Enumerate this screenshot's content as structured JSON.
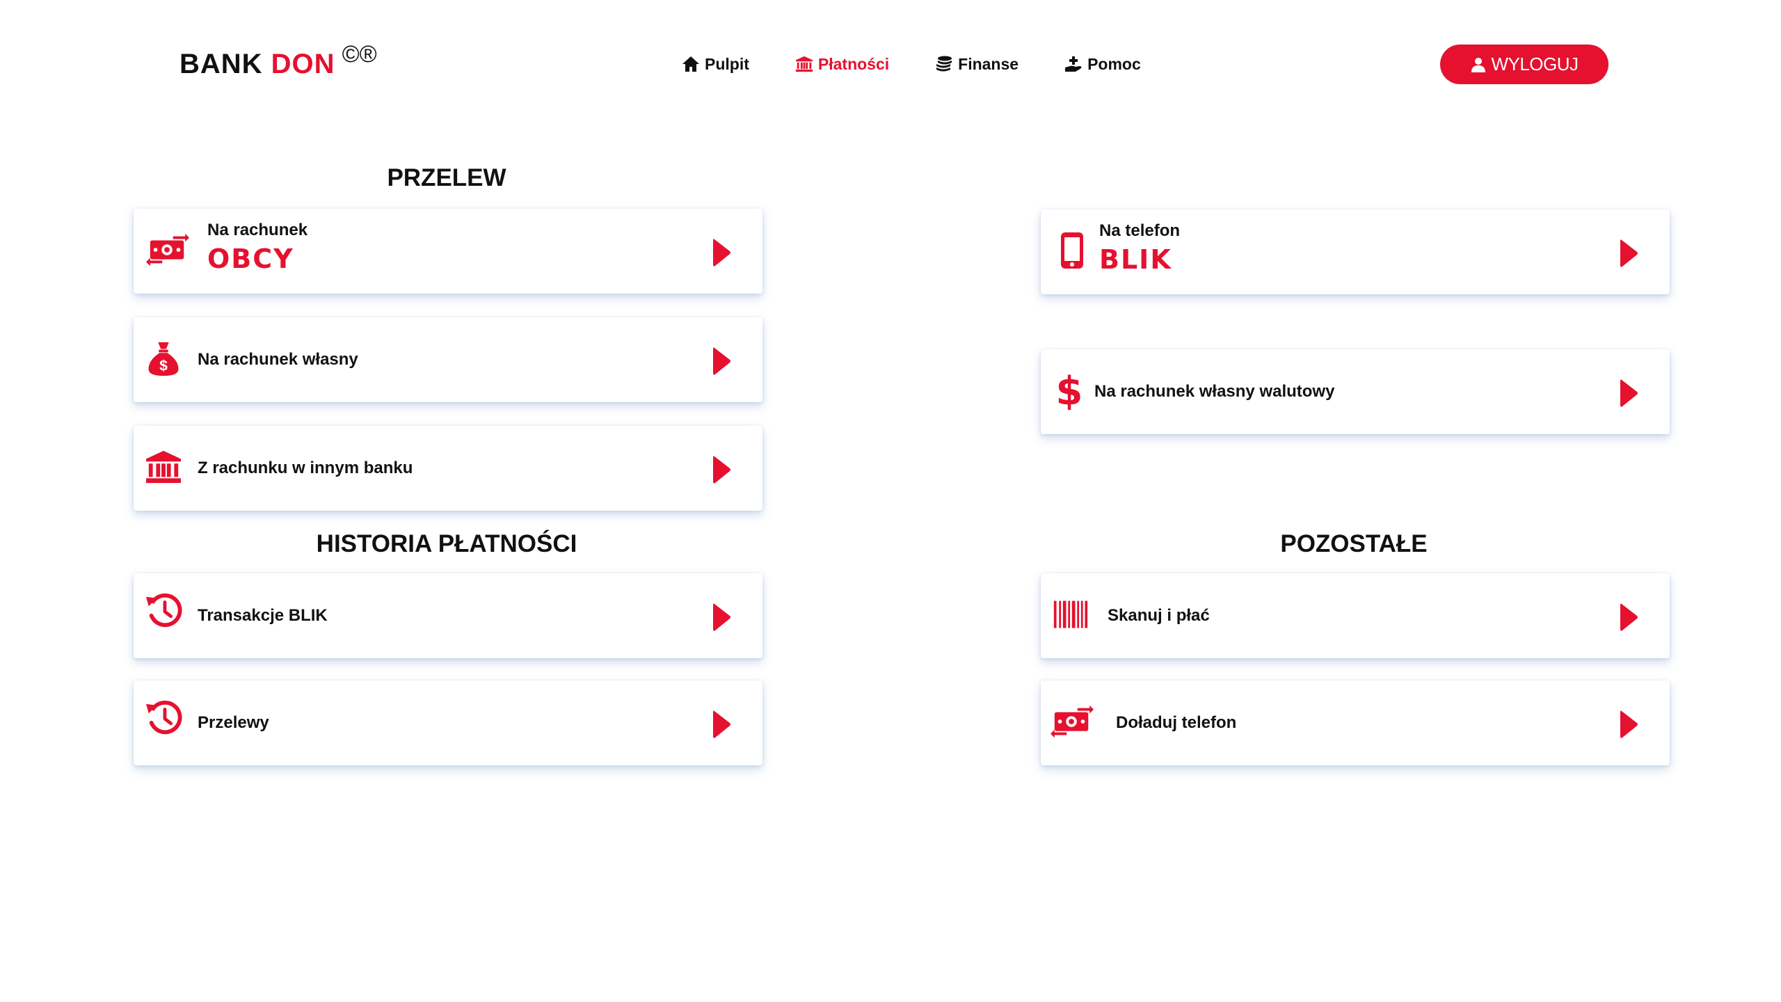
{
  "header": {
    "logo_bank": "BANK",
    "logo_don": "DON",
    "logo_marks": "©®",
    "nav": [
      {
        "label": "Pulpit",
        "icon": "home-icon",
        "active": false
      },
      {
        "label": "Płatności",
        "icon": "bank-icon",
        "active": true
      },
      {
        "label": "Finanse",
        "icon": "coins-icon",
        "active": false
      },
      {
        "label": "Pomoc",
        "icon": "helping-hand-icon",
        "active": false
      }
    ],
    "logout_label": "WYLOGUJ"
  },
  "sections": {
    "przelew": {
      "title": "PRZELEW",
      "items": [
        {
          "small": "Na rachunek",
          "big": "OBCY",
          "icon": "money-transfer-icon"
        },
        {
          "label": "Na rachunek własny",
          "icon": "money-bag-icon"
        },
        {
          "label": "Z rachunku w innym banku",
          "icon": "bank-icon"
        }
      ]
    },
    "right_top": {
      "items": [
        {
          "small": "Na telefon",
          "big": "BLIK",
          "icon": "smartphone-icon"
        },
        {
          "label": "Na rachunek własny walutowy",
          "icon": "dollar-icon"
        }
      ]
    },
    "historia": {
      "title": "HISTORIA PŁATNOŚCI",
      "items": [
        {
          "label": "Transakcje BLIK",
          "icon": "history-icon"
        },
        {
          "label": "Przelewy",
          "icon": "history-icon"
        }
      ]
    },
    "pozostale": {
      "title": "POZOSTAŁE",
      "items": [
        {
          "label": "Skanuj i płać",
          "icon": "barcode-icon"
        },
        {
          "label": "Doładuj telefon",
          "icon": "money-transfer-icon"
        }
      ]
    }
  },
  "colors": {
    "accent": "#e5112f",
    "text": "#111111",
    "background": "#ffffff"
  }
}
